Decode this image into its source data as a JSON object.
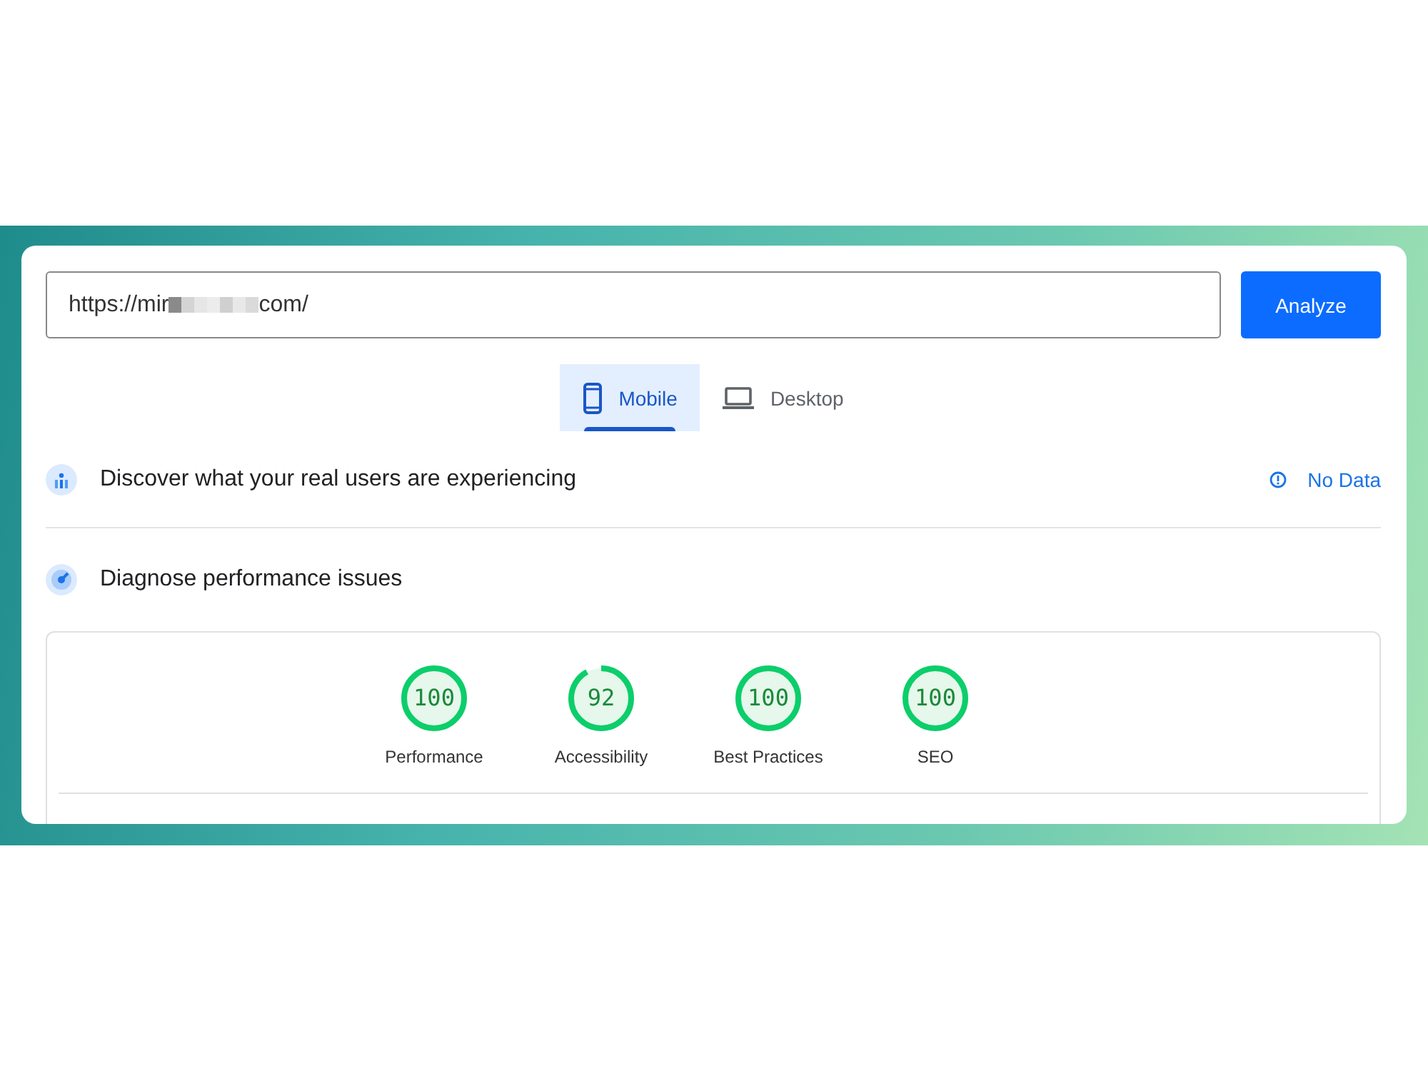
{
  "url_field": {
    "value_start": "https://mir",
    "value_redacted": true,
    "value_end": "com/"
  },
  "analyze_button": "Analyze",
  "tabs": [
    {
      "label": "Mobile",
      "kind": "mobile",
      "selected": true
    },
    {
      "label": "Desktop",
      "kind": "desktop",
      "selected": false
    }
  ],
  "sections": [
    {
      "kind": "field",
      "title": "Discover what your real users are experiencing",
      "status": "No Data"
    },
    {
      "kind": "lab",
      "title": "Diagnose performance issues"
    }
  ],
  "scores": [
    {
      "value": "100",
      "label": "Performance",
      "level": 1
    },
    {
      "value": "92",
      "label": "Accessibility",
      "level": 0.92
    },
    {
      "value": "100",
      "label": "Best Practices",
      "level": 1
    },
    {
      "value": "100",
      "label": "SEO",
      "level": 1
    }
  ]
}
